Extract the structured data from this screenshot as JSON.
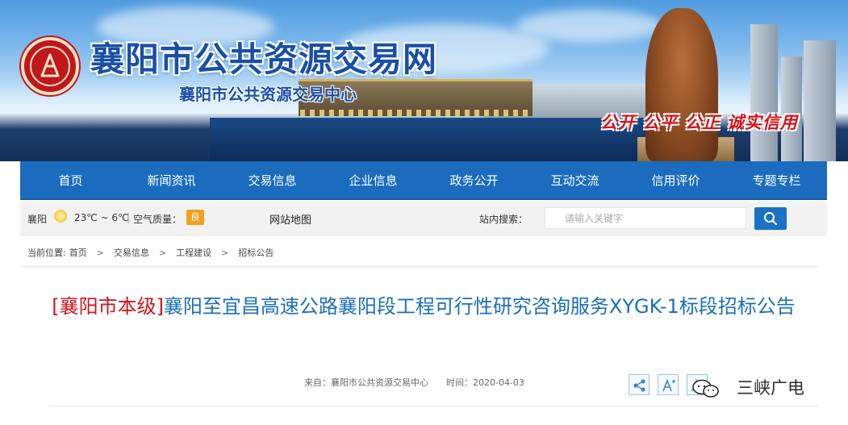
{
  "header": {
    "site_title": "襄阳市公共资源交易网",
    "site_subtitle": "襄阳市公共资源交易中心",
    "slogan": "公开 公平 公正 诚实信用"
  },
  "nav": {
    "items": [
      {
        "label": "首页"
      },
      {
        "label": "新闻资讯"
      },
      {
        "label": "交易信息"
      },
      {
        "label": "企业信息"
      },
      {
        "label": "政务公开"
      },
      {
        "label": "互动交流"
      },
      {
        "label": "信用评价"
      },
      {
        "label": "专题专栏"
      }
    ]
  },
  "infobar": {
    "city": "襄阳",
    "weather_icon": "sun-icon",
    "temperature": "23℃ ~ 6℃",
    "separator": "|",
    "air_quality_label": "空气质量：",
    "air_quality_value": "良",
    "sitemap": "网站地图",
    "search_label": "站内搜索：",
    "search_placeholder": "请输入关键字",
    "search_icon": "search-icon"
  },
  "breadcrumb": {
    "prefix": "当前位置:",
    "items": [
      "首页",
      "交易信息",
      "工程建设",
      "招标公告"
    ],
    "separator": ">"
  },
  "article": {
    "tag": "[襄阳市本级]",
    "title": "襄阳至宜昌高速公路襄阳段工程可行性研究咨询服务XYGK-1标段招标公告",
    "source_label": "来自：",
    "source": "襄阳市公共资源交易中心",
    "time_label": "时间：",
    "time": "2020-04-03"
  },
  "tools": {
    "share_icon": "share-icon",
    "font_increase_icon": "font-increase-icon",
    "font_decrease_icon": "font-decrease-icon"
  },
  "watermark": {
    "text": "三峡广电"
  },
  "colors": {
    "nav_blue": "#1b6cbe",
    "title_blue": "#1a6fb8",
    "tag_red": "#d0141c",
    "air_quality_badge": "#f2a01c"
  }
}
